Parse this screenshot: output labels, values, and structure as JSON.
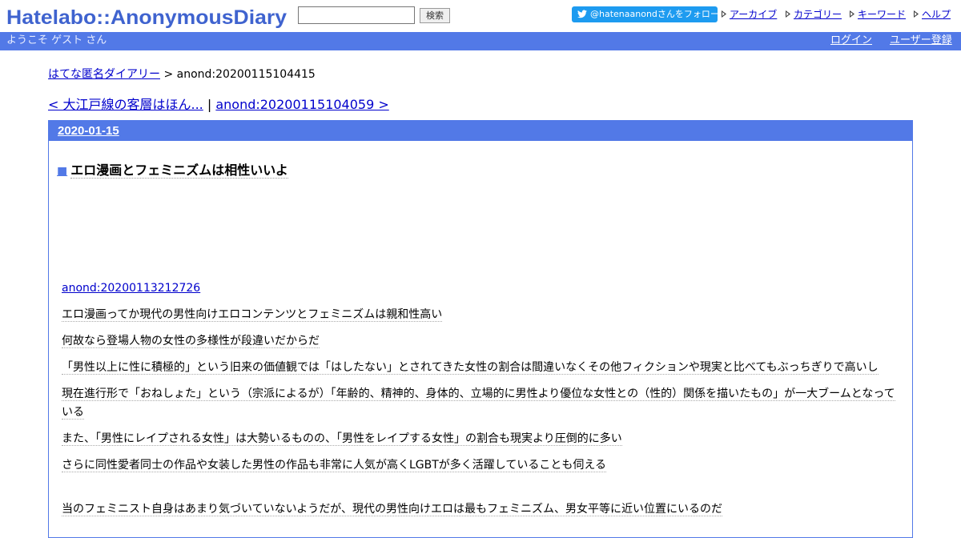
{
  "header": {
    "logo_text": "Hatelabo::AnonymousDiary",
    "search": {
      "value": "",
      "placeholder": ""
    },
    "search_button": "検索",
    "follow_label": "@hatenaanondさんをフォロー",
    "nav": [
      {
        "label": "アーカイブ"
      },
      {
        "label": "カテゴリー"
      },
      {
        "label": "キーワード"
      },
      {
        "label": "ヘルプ"
      }
    ]
  },
  "welcome_bar": {
    "welcome": "ようこそ ゲスト さん",
    "login": "ログイン",
    "register": "ユーザー登録"
  },
  "breadcrumb": {
    "home": "はてな匿名ダイアリー",
    "sep": " > ",
    "current": "anond:20200115104415"
  },
  "pager": {
    "prev": "< 大江戸線の客層はほん...",
    "sep": " | ",
    "next": "anond:20200115104059 >"
  },
  "day": {
    "date": "2020-01-15",
    "entry": {
      "marker": "■",
      "title": "エロ漫画とフェミニズムは相性いいよ",
      "link": "anond:20200113212726",
      "paragraphs": [
        "エロ漫画ってか現代の男性向けエロコンテンツとフェミニズムは親和性高い",
        "何故なら登場人物の女性の多様性が段違いだからだ",
        "「男性以上に性に積極的」という旧来の価値観では「はしたない」とされてきた女性の割合は間違いなくその他フィクションや現実と比べてもぶっちぎりで高いし",
        "現在進行形で「おねしょた」という（宗派によるが）「年齢的、精神的、身体的、立場的に男性より優位な女性との（性的）関係を描いたもの」が一大ブームとなっている",
        "また、「男性にレイプされる女性」は大勢いるものの、「男性をレイプする女性」の割合も現実より圧倒的に多い",
        "さらに同性愛者同士の作品や女装した男性の作品も非常に人気が高くLGBTが多く活躍していることも伺える",
        "",
        "当のフェミニスト自身はあまり気づいていないようだが、現代の男性向けエロは最もフェミニズム、男女平等に近い位置にいるのだ"
      ]
    }
  }
}
